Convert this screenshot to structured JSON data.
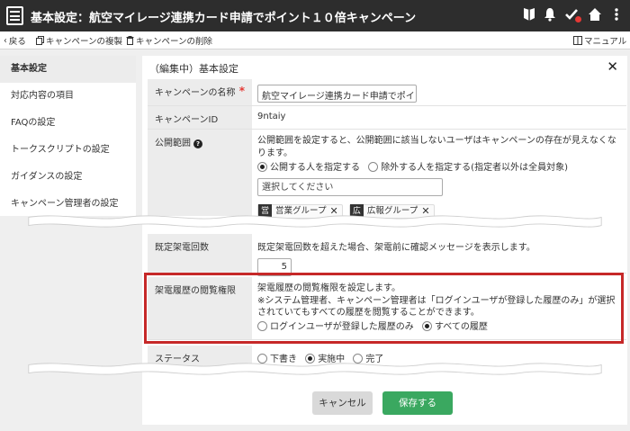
{
  "header": {
    "title": "基本設定：航空マイレージ連携カード申請でポイント１０倍キャンペーン"
  },
  "toolbar": {
    "back": "戻る",
    "copy": "キャンペーンの複製",
    "delete": "キャンペーンの削除",
    "manual": "マニュアル"
  },
  "sidebar": {
    "items": [
      {
        "label": "基本設定"
      },
      {
        "label": "対応内容の項目"
      },
      {
        "label": "FAQの設定"
      },
      {
        "label": "トークスクリプトの設定"
      },
      {
        "label": "ガイダンスの設定"
      },
      {
        "label": "キャンペーン管理者の設定"
      }
    ]
  },
  "panel": {
    "title": "（編集中）基本設定",
    "name_label": "キャンペーンの名称",
    "name_value": "航空マイレージ連携カード申請でポイン",
    "id_label": "キャンペーンID",
    "id_value": "9ntaiy",
    "scope_label": "公開範囲",
    "scope_desc": "公開範囲を設定すると、公開範囲に該当しないユーザはキャンペーンの存在が見えなくなります。",
    "scope_opt1": "公開する人を指定する",
    "scope_opt2": "除外する人を指定する(指定者以外は全員対象)",
    "scope_placeholder": "選択してください",
    "chips": [
      {
        "tag": "営",
        "label": "営業グループ"
      },
      {
        "tag": "広",
        "label": "広報グループ"
      }
    ],
    "retry_label": "既定架電回数",
    "retry_desc": "既定架電回数を超えた場合、架電前に確認メッセージを表示します。",
    "retry_value": "5",
    "history_label": "架電履歴の閲覧権限",
    "history_desc1": "架電履歴の閲覧権限を設定します。",
    "history_desc2": "※システム管理者、キャンペーン管理者は「ログインユーザが登録した履歴のみ」が選択されていてもすべての履歴を閲覧することができます。",
    "history_opt1": "ログインユーザが登録した履歴のみ",
    "history_opt2": "すべての履歴",
    "status_label": "ステータス",
    "status_opt1": "下書き",
    "status_opt2": "実施中",
    "status_opt3": "完了"
  },
  "buttons": {
    "cancel": "キャンセル",
    "save": "保存する"
  },
  "colors": {
    "header_bg": "#2d2d2d",
    "highlight": "#c62828",
    "save": "#3aa860",
    "required": "#e53935"
  }
}
